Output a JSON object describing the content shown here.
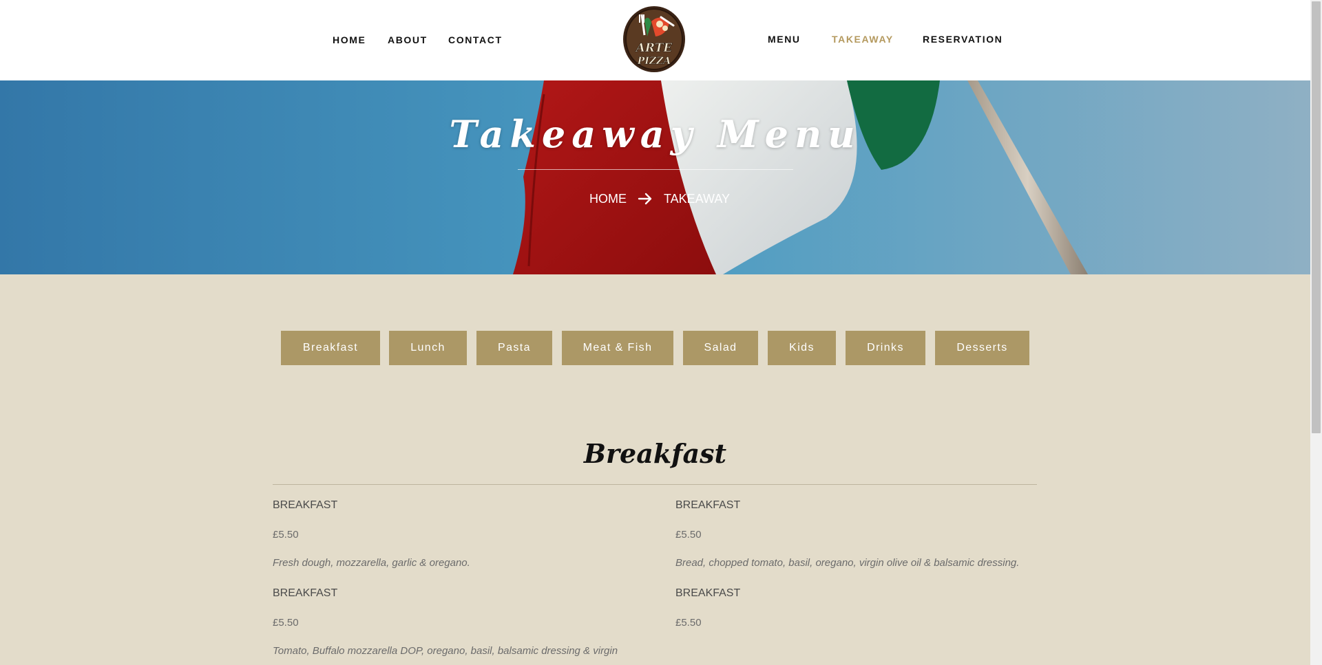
{
  "header": {
    "nav_left": [
      {
        "label": "HOME"
      },
      {
        "label": "ABOUT"
      },
      {
        "label": "CONTACT"
      }
    ],
    "nav_right": [
      {
        "label": "MENU"
      },
      {
        "label": "TAKEAWAY",
        "active": true
      },
      {
        "label": "RESERVATION"
      }
    ],
    "logo_text": "ARTE PIZZA"
  },
  "hero": {
    "title": "Takeaway Menu",
    "breadcrumb": {
      "home": "HOME",
      "current": "TAKEAWAY",
      "separator_icon": "arrow-right-icon"
    }
  },
  "categories": [
    "Breakfast",
    "Lunch",
    "Pasta",
    "Meat & Fish",
    "Salad",
    "Kids",
    "Drinks",
    "Desserts"
  ],
  "section": {
    "title": "Breakfast",
    "items": [
      {
        "name": "BREAKFAST",
        "price": "£5.50",
        "description": "Fresh dough, mozzarella, garlic & oregano."
      },
      {
        "name": "BREAKFAST",
        "price": "£5.50",
        "description": "Bread, chopped tomato, basil, oregano, virgin olive oil & balsamic dressing."
      },
      {
        "name": "BREAKFAST",
        "price": "£5.50",
        "description": "Tomato, Buffalo mozzarella DOP, oregano, basil, balsamic dressing & virgin olive oil."
      },
      {
        "name": "BREAKFAST",
        "price": "£5.50",
        "description": ""
      }
    ]
  },
  "colors": {
    "accent": "#b4995e",
    "button_bg": "#ac9866",
    "page_bg": "#e3dcca",
    "header_bg": "#ffffff"
  }
}
